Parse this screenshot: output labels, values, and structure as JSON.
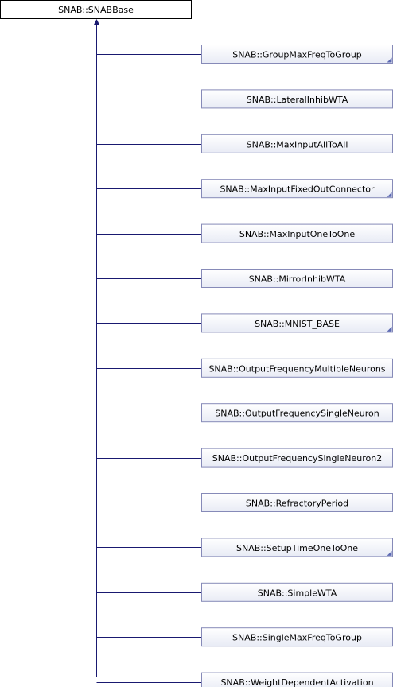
{
  "base_class": {
    "label": "SNAB::SNABBase"
  },
  "derived_classes": [
    {
      "label": "SNAB::GroupMaxFreqToGroup",
      "has_more": true
    },
    {
      "label": "SNAB::LateralInhibWTA",
      "has_more": false
    },
    {
      "label": "SNAB::MaxInputAllToAll",
      "has_more": false
    },
    {
      "label": "SNAB::MaxInputFixedOutConnector",
      "has_more": true
    },
    {
      "label": "SNAB::MaxInputOneToOne",
      "has_more": false
    },
    {
      "label": "SNAB::MirrorInhibWTA",
      "has_more": false
    },
    {
      "label": "SNAB::MNIST_BASE",
      "has_more": true
    },
    {
      "label": "SNAB::OutputFrequencyMultipleNeurons",
      "has_more": false
    },
    {
      "label": "SNAB::OutputFrequencySingleNeuron",
      "has_more": false
    },
    {
      "label": "SNAB::OutputFrequencySingleNeuron2",
      "has_more": false
    },
    {
      "label": "SNAB::RefractoryPeriod",
      "has_more": false
    },
    {
      "label": "SNAB::SetupTimeOneToOne",
      "has_more": true
    },
    {
      "label": "SNAB::SimpleWTA",
      "has_more": false
    },
    {
      "label": "SNAB::SingleMaxFreqToGroup",
      "has_more": false
    },
    {
      "label": "SNAB::WeightDependentActivation",
      "has_more": false
    }
  ],
  "colors": {
    "connector": "#191970",
    "box_border": "#868ab8",
    "box_fill_top": "#ffffff",
    "box_fill_bottom": "#e8ebf5",
    "corner_mark": "#5d6ab3"
  }
}
